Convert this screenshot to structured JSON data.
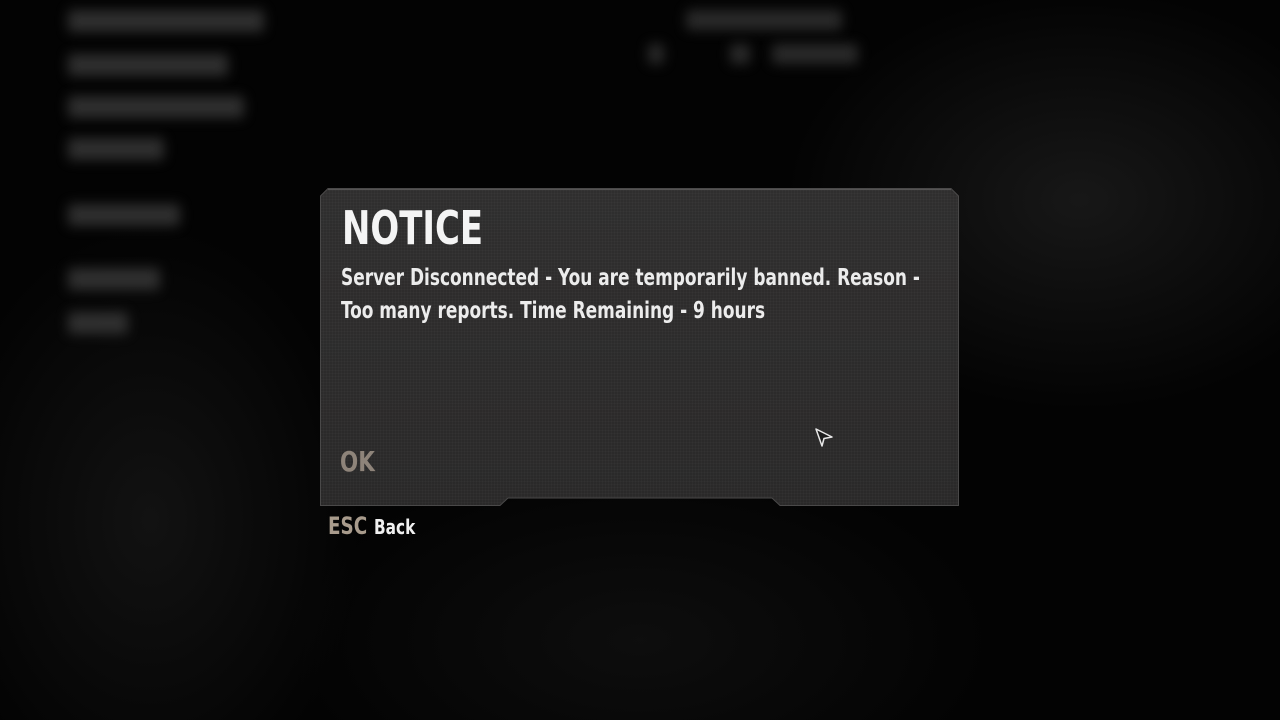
{
  "dialog": {
    "title": "NOTICE",
    "message": "Server Disconnected - You are temporarily banned. Reason - Too many reports. Time Remaining - 9 hours",
    "ok_label": "OK"
  },
  "footer": {
    "key_label": "ESC",
    "action_label": "Back"
  },
  "icons": {
    "cursor": "mouse-cursor-icon"
  },
  "colors": {
    "dialog_bg": "#2c2b2b",
    "title_text": "#f4f4f4",
    "ok_text": "#8e847a",
    "esc_text": "#a89b8c"
  }
}
